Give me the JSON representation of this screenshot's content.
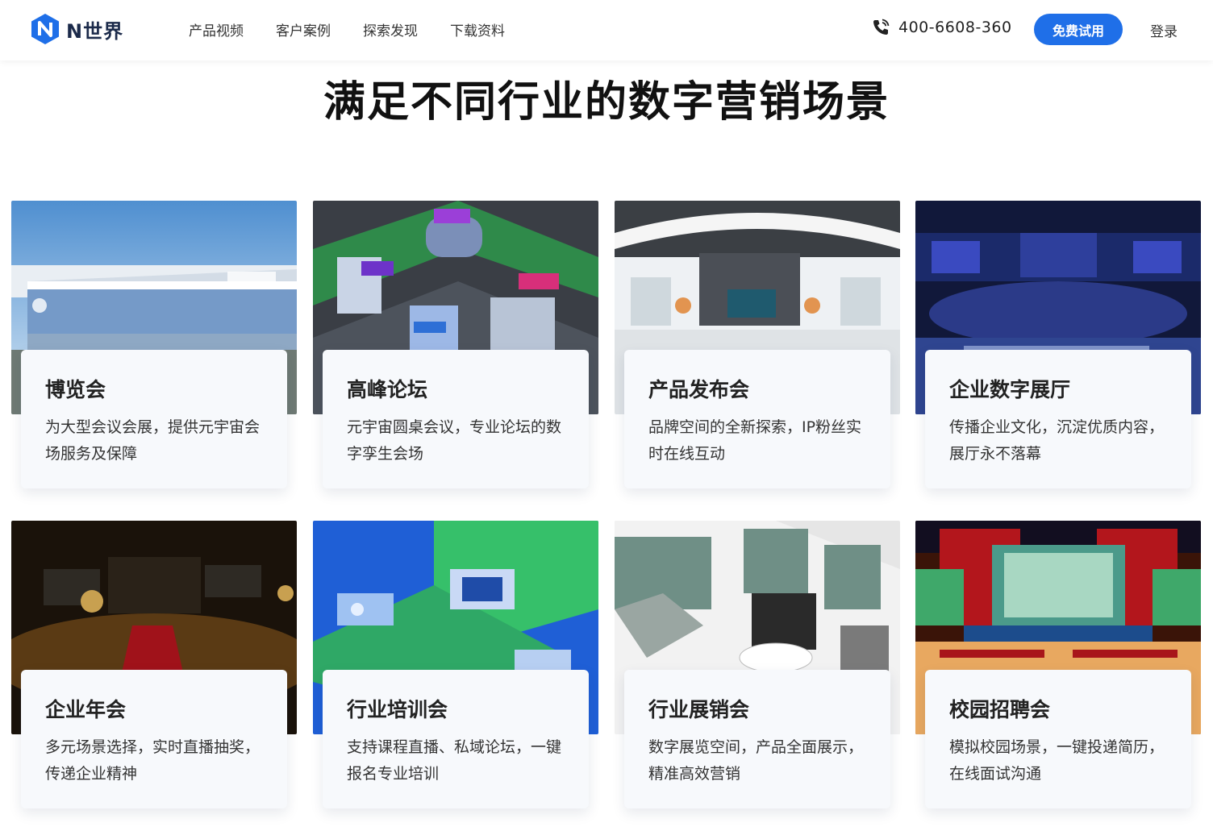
{
  "brand": {
    "name": "N世界",
    "logo_icon": "n-logo-icon",
    "accent": "#1f6fe8"
  },
  "nav": {
    "items": [
      "产品视频",
      "客户案例",
      "探索发现",
      "下载资料"
    ]
  },
  "header": {
    "phone_icon": "phone-icon",
    "phone": "400-6608-360",
    "trial_label": "免费试用",
    "login_label": "登录"
  },
  "main": {
    "title": "满足不同行业的数字营销场景",
    "cards": [
      {
        "title": "博览会",
        "desc": "为大型会议会展，提供元宇宙会场服务及保障",
        "image": "convention-center-image"
      },
      {
        "title": "高峰论坛",
        "desc": "元宇宙圆桌会议，专业论坛的数字孪生会场",
        "image": "isometric-city-image"
      },
      {
        "title": "产品发布会",
        "desc": "品牌空间的全新探索，IP粉丝实时在线互动",
        "image": "launch-hall-image"
      },
      {
        "title": "企业数字展厅",
        "desc": "传播企业文化，沉淀优质内容，展厅永不落幕",
        "image": "stage-hall-image"
      },
      {
        "title": "企业年会",
        "desc": "多元场景选择，实时直播抽奖，传递企业精神",
        "image": "annual-gala-image"
      },
      {
        "title": "行业培训会",
        "desc": "支持课程直播、私域论坛，一键报名专业培训",
        "image": "training-space-image"
      },
      {
        "title": "行业展销会",
        "desc": "数字展览空间，产品全面展示，精准高效营销",
        "image": "expo-floor-image"
      },
      {
        "title": "校园招聘会",
        "desc": "模拟校园场景，一键投递简历，在线面试沟通",
        "image": "campus-stage-image"
      }
    ]
  }
}
